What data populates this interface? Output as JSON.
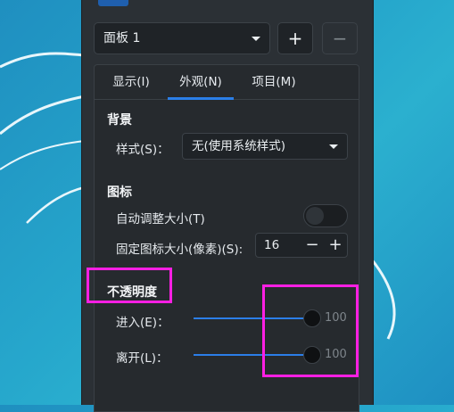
{
  "panel_select": {
    "value": "面板 1"
  },
  "panel_buttons": {
    "add": "+",
    "remove": "−"
  },
  "tabs": [
    {
      "label": "显示(I)",
      "active": false
    },
    {
      "label": "外观(N)",
      "active": true
    },
    {
      "label": "项目(M)",
      "active": false
    }
  ],
  "background": {
    "title": "背景",
    "style_label": "样式(S)：",
    "style_value": "无(使用系统样式)"
  },
  "icons": {
    "title": "图标",
    "auto_size_label": "自动调整大小(T)",
    "auto_size_on": false,
    "fixed_size_label": "固定图标大小(像素)(S):",
    "fixed_size_value": "16",
    "minus": "−",
    "plus": "+"
  },
  "opacity": {
    "title": "不透明度",
    "enter_label": "进入(E)：",
    "enter_value": "100",
    "enter_level": 1.0,
    "leave_label": "离开(L)：",
    "leave_value": "100",
    "leave_level": 1.0
  },
  "colors": {
    "accent": "#2b7ee8",
    "highlight": "#ff1fe3"
  }
}
